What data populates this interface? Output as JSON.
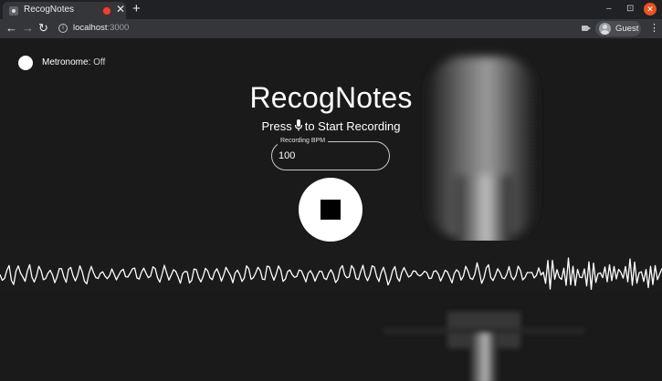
{
  "browser": {
    "tab_title": "RecogNotes",
    "tab_close": "✕",
    "new_tab": "+",
    "recording_indicator": "record-dot-icon",
    "window_controls": {
      "minimize": "–",
      "maximize": "⊡",
      "close": "✕"
    },
    "nav": {
      "back": "←",
      "forward": "→",
      "reload": "↻"
    },
    "url_host": "localhost",
    "url_port": ":3000",
    "profile_name": "Guest",
    "menu": "⋮"
  },
  "page": {
    "metronome_label": "Metronome:",
    "metronome_state": "Off",
    "title": "RecogNotes",
    "subtitle_before": "Press",
    "subtitle_after": "to Start Recording",
    "bpm_label": "Recording BPM",
    "bpm_value": "100",
    "record_button_icon": "stop-icon"
  },
  "colors": {
    "page_background": "#1a1a1a",
    "text": "#ffffff",
    "chrome_dark": "#202124",
    "chrome_toolbar": "#35363a",
    "recording_red": "#ea4335",
    "window_close": "#e95420"
  }
}
